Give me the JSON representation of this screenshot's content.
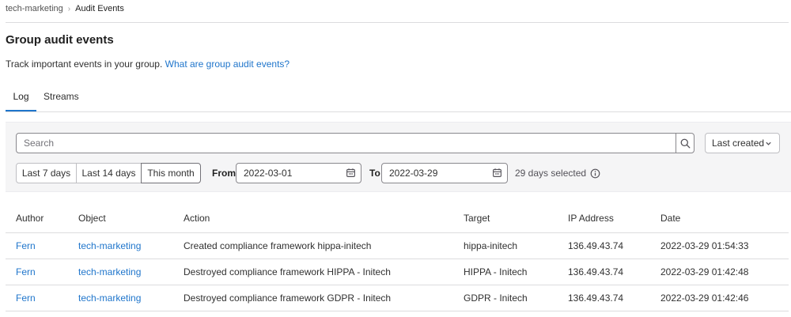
{
  "breadcrumb": {
    "group": "tech-marketing",
    "current": "Audit Events"
  },
  "page": {
    "title": "Group audit events",
    "description": "Track important events in your group.",
    "help_link": "What are group audit events?"
  },
  "tabs": [
    {
      "label": "Log",
      "active": true
    },
    {
      "label": "Streams",
      "active": false
    }
  ],
  "filters": {
    "search_placeholder": "Search",
    "sort_label": "Last created",
    "ranges": [
      "Last 7 days",
      "Last 14 days",
      "This month"
    ],
    "selected_range": "This month",
    "from_label": "From",
    "from_value": "2022-03-01",
    "to_label": "To",
    "to_value": "2022-03-29",
    "days_selected": "29 days selected"
  },
  "table": {
    "columns": [
      "Author",
      "Object",
      "Action",
      "Target",
      "IP Address",
      "Date"
    ],
    "rows": [
      {
        "author": "Fern",
        "object": "tech-marketing",
        "action": "Created compliance framework hippa-initech",
        "target": "hippa-initech",
        "ip": "136.49.43.74",
        "date": "2022-03-29 01:54:33"
      },
      {
        "author": "Fern",
        "object": "tech-marketing",
        "action": "Destroyed compliance framework HIPPA - Initech",
        "target": "HIPPA - Initech",
        "ip": "136.49.43.74",
        "date": "2022-03-29 01:42:48"
      },
      {
        "author": "Fern",
        "object": "tech-marketing",
        "action": "Destroyed compliance framework GDPR - Initech",
        "target": "GDPR - Initech",
        "ip": "136.49.43.74",
        "date": "2022-03-29 01:42:46"
      }
    ]
  },
  "colors": {
    "link": "#1f75cb",
    "border": "#dcdcde",
    "panel": "#f5f5f6"
  }
}
